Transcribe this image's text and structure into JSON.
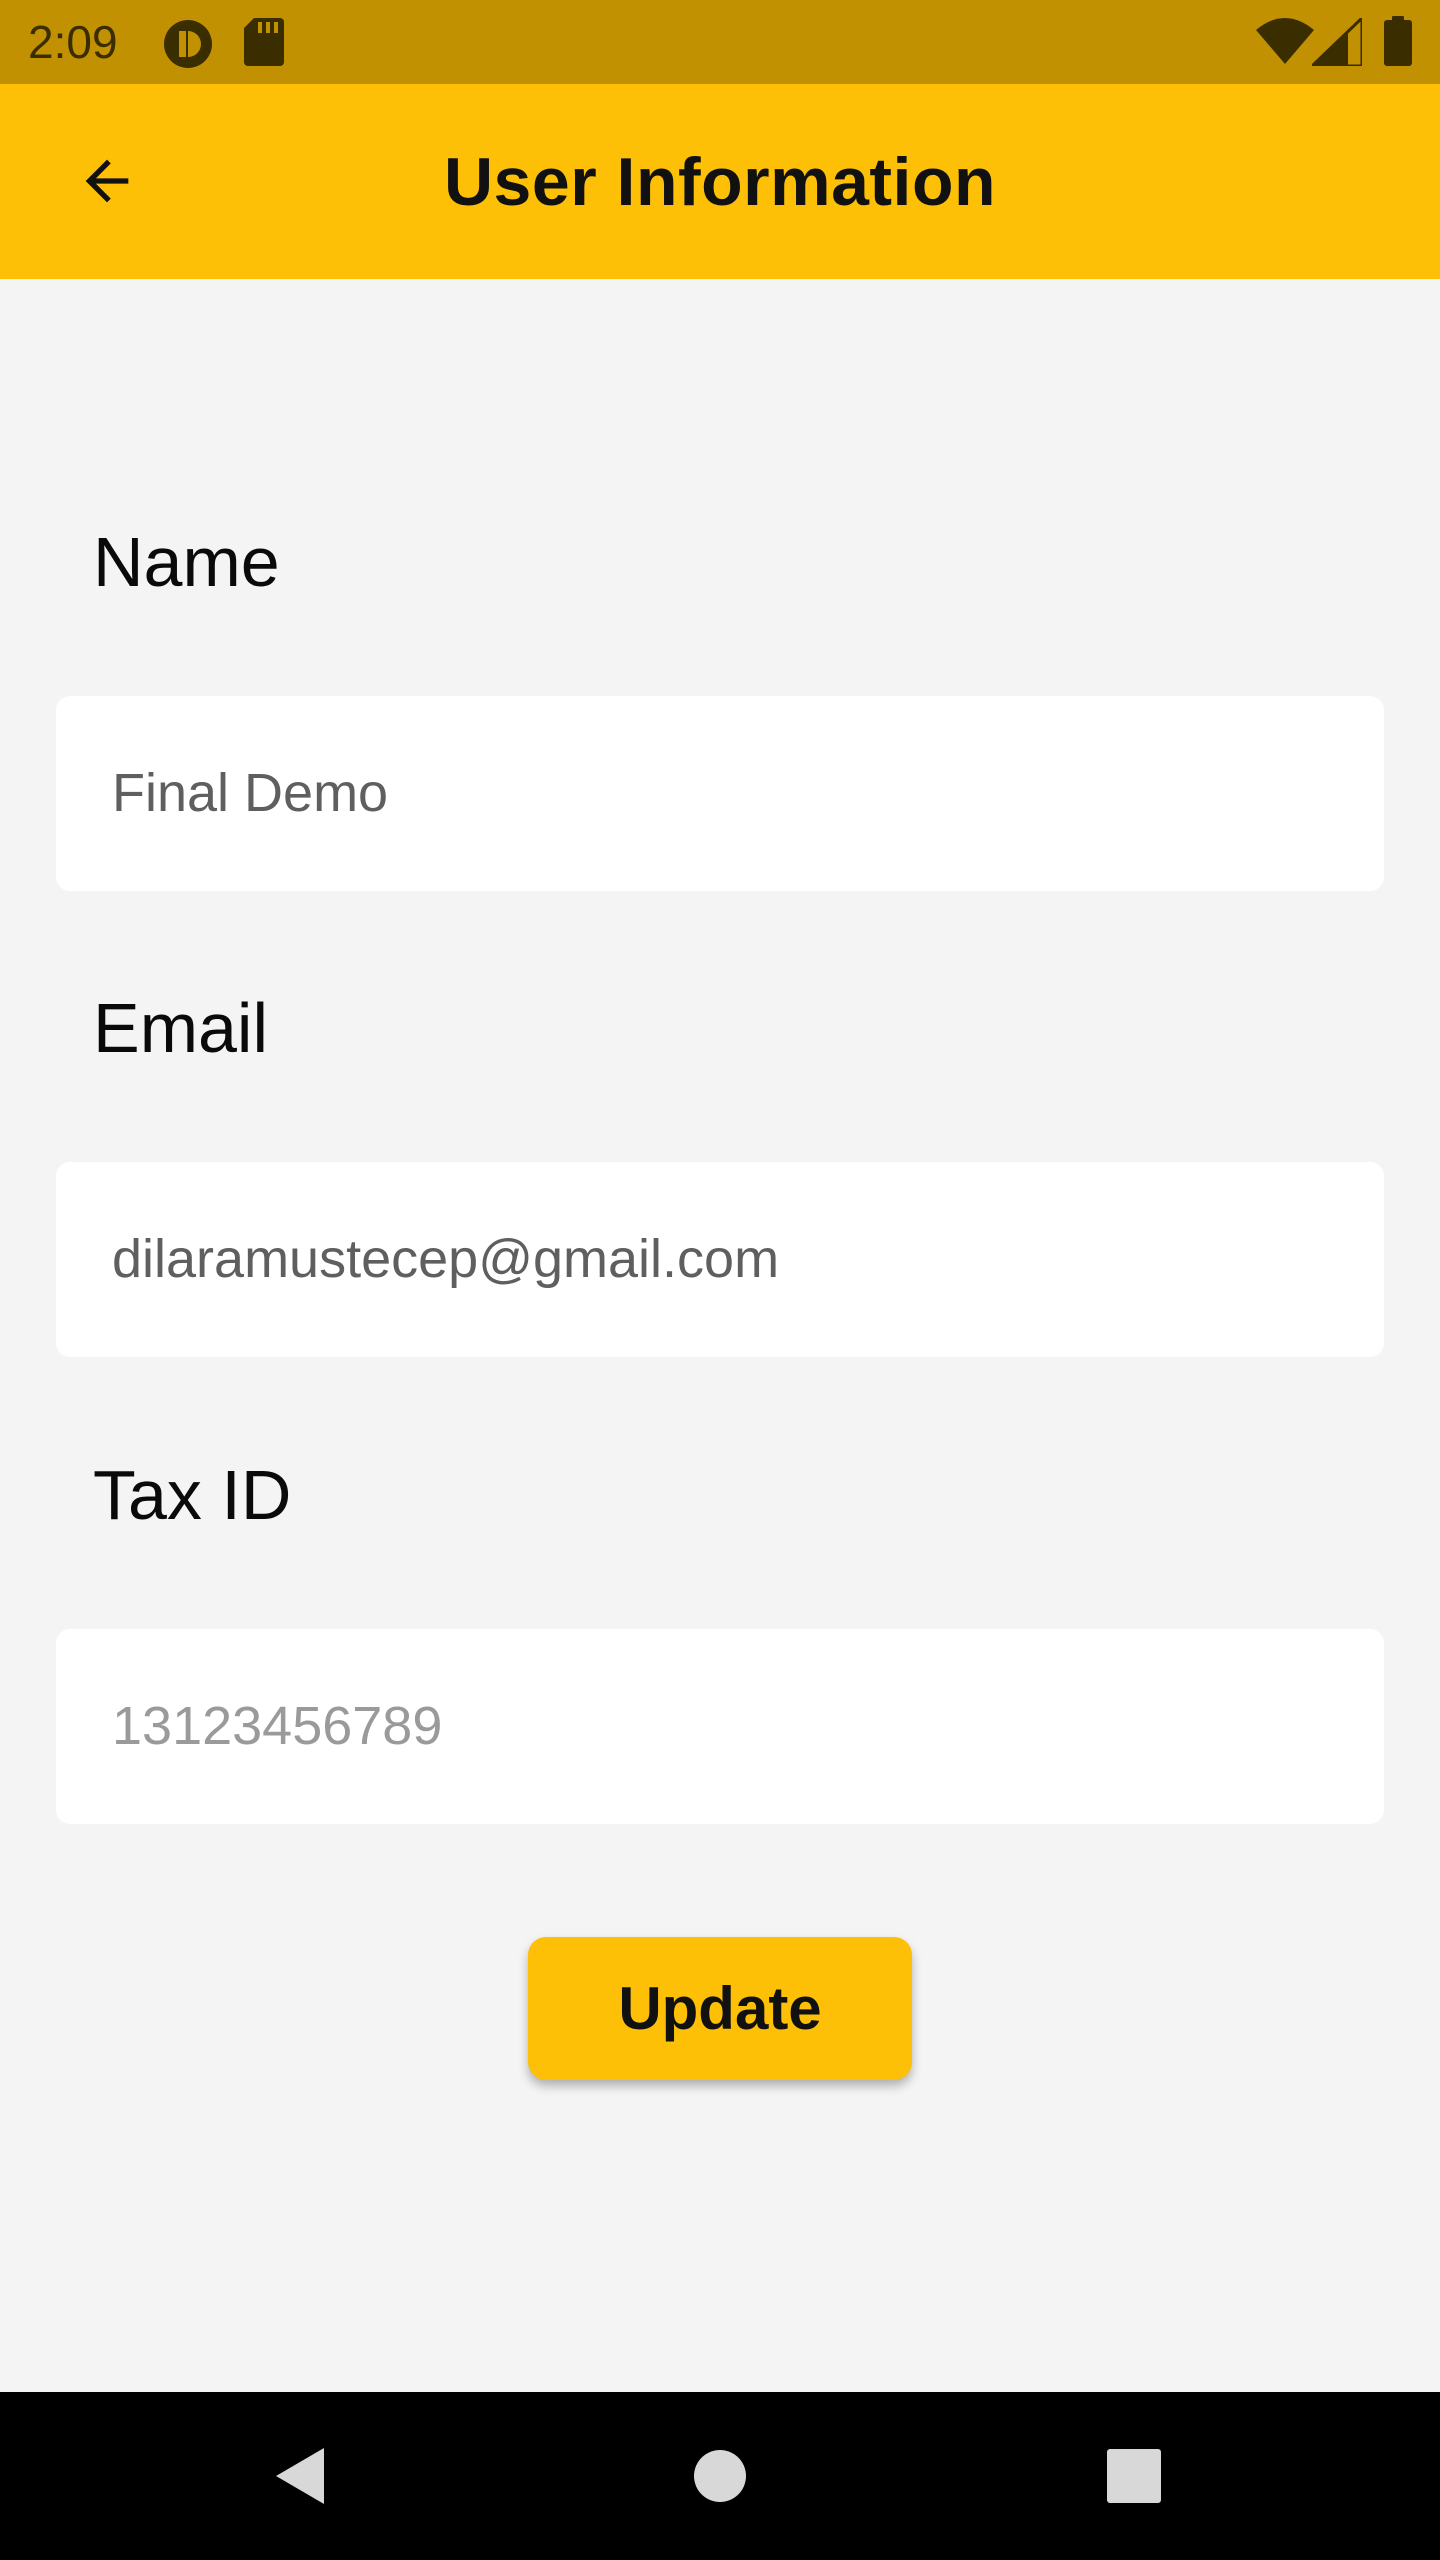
{
  "status_bar": {
    "time": "2:09",
    "icons_left": [
      "app-notification-icon",
      "sd-card-icon"
    ],
    "icons_right": [
      "wifi-icon",
      "cellular-signal-icon",
      "battery-icon"
    ]
  },
  "app_bar": {
    "title": "User Information",
    "back_icon": "arrow-back-icon",
    "color": "#fdc007"
  },
  "form": {
    "name": {
      "label": "Name",
      "value": "Final Demo"
    },
    "email": {
      "label": "Email",
      "value": "dilaramustecep@gmail.com"
    },
    "tax_id": {
      "label": "Tax ID",
      "placeholder": "13123456789"
    },
    "update_label": "Update"
  },
  "nav_bar": {
    "icons": [
      "back-triangle-icon",
      "home-circle-icon",
      "recents-square-icon"
    ]
  },
  "colors": {
    "accent": "#fdc007",
    "status_bar": "#c29102",
    "background": "#f4f4f4"
  }
}
